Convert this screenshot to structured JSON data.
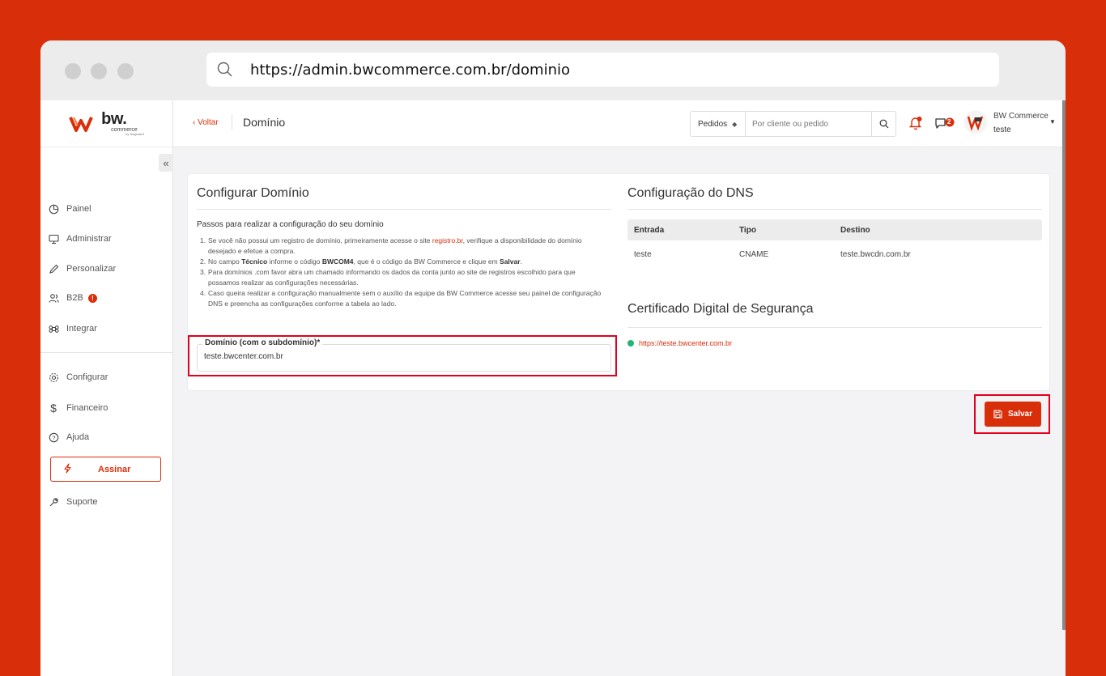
{
  "browser": {
    "url": "https://admin.bwcommerce.com.br/dominio"
  },
  "logo": {
    "main": "bw.",
    "sub": "commerce",
    "by": "by wagzoard"
  },
  "sidebar": {
    "collapse_label": "«",
    "items": [
      {
        "label": "Painel",
        "icon": "pie-chart-icon"
      },
      {
        "label": "Administrar",
        "icon": "monitor-icon"
      },
      {
        "label": "Personalizar",
        "icon": "pencil-icon"
      },
      {
        "label": "B2B",
        "icon": "users-icon",
        "badge": "!"
      },
      {
        "label": "Integrar",
        "icon": "command-icon"
      },
      {
        "label": "Configurar",
        "icon": "gear-icon"
      },
      {
        "label": "Financeiro",
        "icon": "dollar-icon"
      },
      {
        "label": "Ajuda",
        "icon": "help-circle-icon"
      },
      {
        "label": "Suporte",
        "icon": "wrench-icon"
      }
    ],
    "cta": {
      "label": "Assinar",
      "icon": "bolt-icon"
    }
  },
  "topbar": {
    "back_label": "‹ Voltar",
    "page_title": "Domínio",
    "search_select": "Pedidos",
    "search_placeholder": "Por cliente ou pedido",
    "chat_badge": "2",
    "user_name": "BW Commerce",
    "user_store": "teste"
  },
  "config": {
    "title": "Configurar Domínio",
    "steps_title": "Passos para realizar a configuração do seu domínio",
    "steps": [
      {
        "num": "1.",
        "a": "Se você não possui um registro de domínio, primeiramente acesse o site ",
        "link": "registro.br",
        "b": ", verifique a disponibilidade do domínio desejado e efetue a compra."
      },
      {
        "num": "2.",
        "a": "No campo ",
        "b1": "Técnico",
        "c": " informe o código ",
        "b2": "BWCOM4",
        "d": ", que é o código da BW Commerce e clique em ",
        "b3": "Salvar",
        "e": "."
      },
      {
        "num": "3.",
        "text": "Para domínios .com favor abra um chamado informando os dados da conta junto ao site de registros escolhido para que possamos realizar as configurações necessárias."
      },
      {
        "num": "4.",
        "text": "Caso queira realizar a configuração manualmente sem o auxílio da equipe da BW Commerce acesse seu painel de configuração DNS e preencha as configurações conforme a tabela ao lado."
      }
    ],
    "field_label": "Domínio (com o subdomínio)*",
    "field_value": "teste.bwcenter.com.br"
  },
  "dns": {
    "title": "Configuração do DNS",
    "headers": [
      "Entrada",
      "Tipo",
      "Destino"
    ],
    "rows": [
      [
        "teste",
        "CNAME",
        "teste.bwcdn.com.br"
      ]
    ]
  },
  "certificate": {
    "title": "Certificado Digital de Segurança",
    "url": "https://teste.bwcenter.com.br",
    "status_color": "#22b573"
  },
  "actions": {
    "save_label": "Salvar"
  },
  "colors": {
    "brand": "#d92e0a",
    "highlight": "#e3001b"
  }
}
